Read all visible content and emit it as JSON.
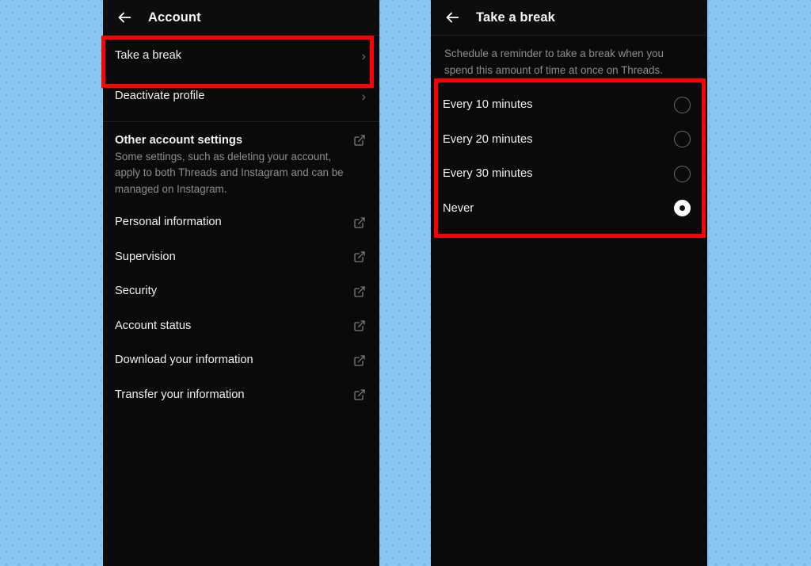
{
  "background": {
    "color": "#8ac5f2",
    "dot_color": "#2a6ca0"
  },
  "annotations": {
    "color": "#fe0000",
    "boxes": [
      {
        "name": "take-a-break-row-highlight",
        "target": "Take a break"
      },
      {
        "name": "break-interval-options-highlight",
        "target": "Break reminder interval options"
      }
    ]
  },
  "left_screen": {
    "header": {
      "back_icon": "arrow-left-icon",
      "title": "Account"
    },
    "primary_rows": [
      {
        "label": "Take a break",
        "accessory": "chevron-right-icon",
        "highlighted": true
      },
      {
        "label": "Deactivate profile",
        "accessory": "chevron-right-icon",
        "highlighted": false
      }
    ],
    "section": {
      "title": "Other account settings",
      "accessory": "external-link-icon",
      "description": "Some settings, such as deleting your account, apply to both Threads and Instagram and can be managed on Instagram."
    },
    "external_rows": [
      {
        "label": "Personal information",
        "accessory": "external-link-icon"
      },
      {
        "label": "Supervision",
        "accessory": "external-link-icon"
      },
      {
        "label": "Security",
        "accessory": "external-link-icon"
      },
      {
        "label": "Account status",
        "accessory": "external-link-icon"
      },
      {
        "label": "Download your information",
        "accessory": "external-link-icon"
      },
      {
        "label": "Transfer your information",
        "accessory": "external-link-icon"
      }
    ]
  },
  "right_screen": {
    "header": {
      "back_icon": "arrow-left-icon",
      "title": "Take a break"
    },
    "intro": "Schedule a reminder to take a break when you spend this amount of time at once on Threads.",
    "options": [
      {
        "label": "Every 10 minutes",
        "selected": false
      },
      {
        "label": "Every 20 minutes",
        "selected": false
      },
      {
        "label": "Every 30 minutes",
        "selected": false
      },
      {
        "label": "Never",
        "selected": true
      }
    ],
    "selected_option": "Never"
  }
}
